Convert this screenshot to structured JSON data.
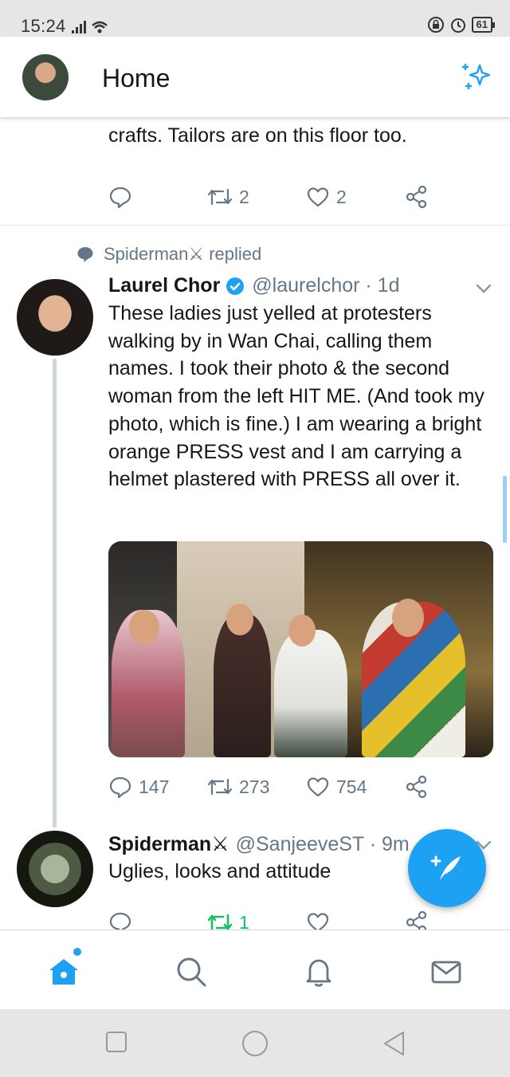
{
  "status_bar": {
    "time": "15:24",
    "battery": "61"
  },
  "header": {
    "title": "Home"
  },
  "feed": {
    "previous_tweet": {
      "text": "lemak, roti canai, etc.. And clothes le batik, crafts. Tailors are on this floor too.",
      "replies": "",
      "retweets": "2",
      "likes": "2"
    },
    "context": {
      "text": "Spiderman⚔ replied"
    },
    "main_tweet": {
      "name": "Laurel Chor",
      "handle": "@laurelchor · 1d",
      "text": "These ladies just yelled at protesters walking by in Wan Chai, calling them names. I took their photo & the second woman from the left HIT ME. (And took my photo, which is fine.) I am wearing a bright orange PRESS vest and I am carrying a helmet plastered with PRESS all over it.",
      "replies": "147",
      "retweets": "273",
      "likes": "754"
    },
    "reply_tweet": {
      "name": "Spiderman⚔",
      "handle": "@SanjeeveST · 9m",
      "text": "Uglies, looks and attitude",
      "replies": "",
      "retweets": "1",
      "likes": ""
    }
  },
  "bottom_nav": [
    "home-icon",
    "search-icon",
    "bell-icon",
    "mail-icon"
  ],
  "colors": {
    "accent": "#1da1f2",
    "muted": "#657786",
    "retweet_active": "#17bf63"
  }
}
